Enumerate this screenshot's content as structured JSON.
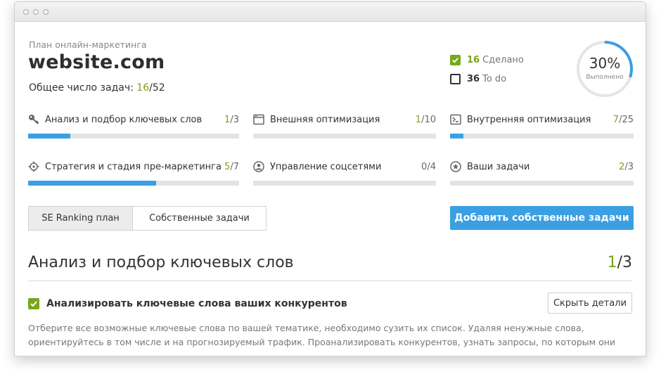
{
  "window": {
    "controls": [
      "close-dot",
      "minimize-dot",
      "zoom-dot"
    ]
  },
  "header": {
    "subtitle": "План онлайн-маркетинга",
    "site": "website.com",
    "total_label": "Общее число задач:",
    "total_done": "16",
    "total_sep": "/",
    "total_all": "52"
  },
  "legend": {
    "done_count": "16",
    "done_label": "Сделано",
    "todo_count": "36",
    "todo_label": "To do"
  },
  "progress": {
    "percent_text": "30%",
    "label": "Выполнено",
    "fraction": 0.3
  },
  "categories": [
    {
      "icon": "key-icon",
      "name": "Анализ и подбор ключевых слов",
      "done": "1",
      "total": "3",
      "fill": 0.2
    },
    {
      "icon": "browser-window-icon",
      "name": "Внешняя оптимизация",
      "done": "1",
      "total": "10",
      "fill": 0
    },
    {
      "icon": "terminal-icon",
      "name": "Внутренняя оптимизация",
      "done": "7",
      "total": "25",
      "fill": 0.0733
    },
    {
      "icon": "target-icon",
      "name": "Стратегия и стадия пре-маркетинга",
      "done": "5",
      "total": "7",
      "fill": 0.6067
    },
    {
      "icon": "user-circle-icon",
      "name": "Управление соцсетями",
      "done": "0",
      "total": "4",
      "fill": 0
    },
    {
      "icon": "star-circle-icon",
      "name": "Ваши задачи",
      "done": "2",
      "total": "3",
      "fill": 0
    }
  ],
  "tabs": {
    "active": "SE Ranking план",
    "inactive": "Собственные задачи"
  },
  "buttons": {
    "add_tasks": "Добавить собственные задачи",
    "hide_details": "Скрыть детали"
  },
  "section": {
    "title": "Анализ и подбор ключевых слов",
    "done": "1",
    "sep": "/",
    "total": "3"
  },
  "task": {
    "checked": true,
    "title": "Анализировать ключевые слова ваших конкурентов",
    "description_line1": "Отберите все возможные ключевые слова по вашей тематике, необходимо сузить их список. Удаляя ненужные слова,",
    "description_line2": "ориентируйтесь в том числе и на прогнозируемый трафик. Проанализировать конкурентов, узнать запросы, по которым они"
  },
  "colors": {
    "accent_blue": "#3a9fe3",
    "done_green": "#7aa516",
    "bar_bg": "#e3e3e3"
  }
}
